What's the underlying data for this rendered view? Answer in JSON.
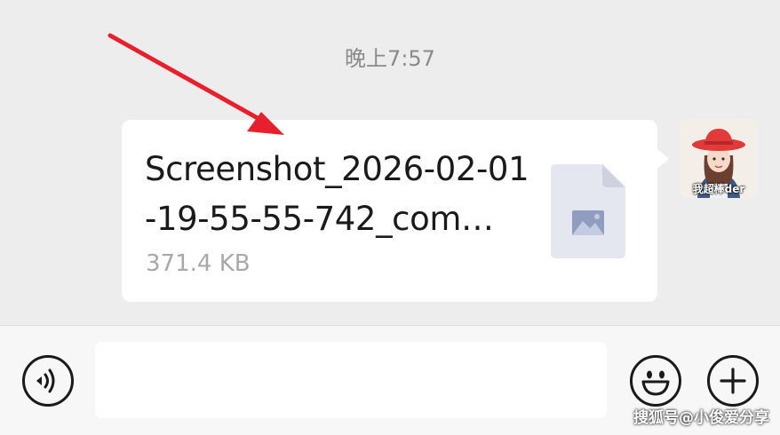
{
  "chat": {
    "timestamp": "晚上7:57",
    "message": {
      "file_name": "Screenshot_2026-02-01-19-55-55-742_com…",
      "file_size": "371.4 KB",
      "file_icon": "image-file-icon"
    },
    "avatar": {
      "caption": "我超棒der"
    }
  },
  "input_bar": {
    "text_value": "",
    "voice_icon": "voice-icon",
    "emoji_icon": "smiley-icon",
    "plus_icon": "plus-icon"
  },
  "watermark": "搜狐号@小俊爱分享",
  "colors": {
    "background": "#ededed",
    "bubble": "#ffffff",
    "annotation_arrow": "#e8202e",
    "file_icon": "#e4e7ef",
    "file_icon_image": "#8f9dbf"
  }
}
